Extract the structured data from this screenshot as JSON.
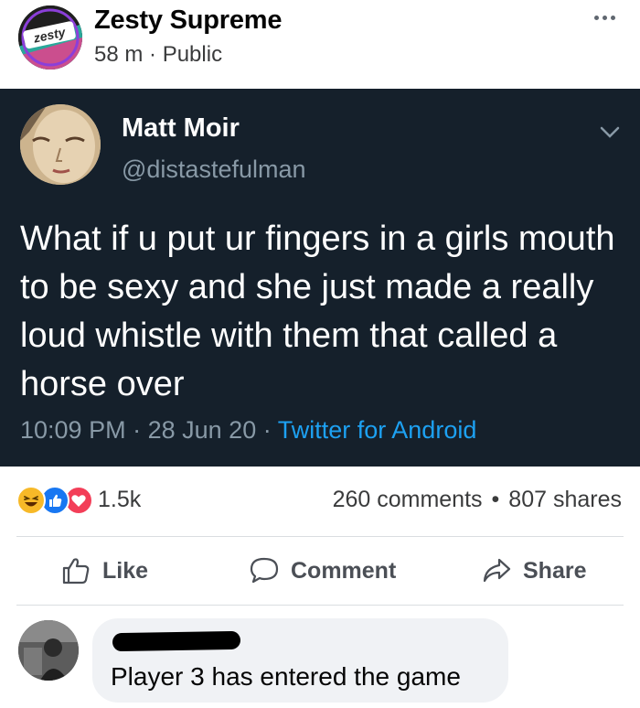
{
  "post": {
    "page_name": "Zesty Supreme",
    "avatar_text": "zesty",
    "time": "58 m",
    "separator": "·",
    "visibility": "Public"
  },
  "tweet": {
    "display_name": "Matt Moir",
    "handle": "@distastefulman",
    "text": "What if u put ur fingers in a girls mouth to be sexy and she just made a really loud whistle with them that called a horse over",
    "time": "10:09 PM",
    "date": "28 Jun 20",
    "separator": "·",
    "source": "Twitter for Android"
  },
  "reactions": {
    "icons": [
      "haha-icon",
      "like-icon",
      "love-icon"
    ],
    "count": "1.5k",
    "comments": "260 comments",
    "separator": "•",
    "shares": "807 shares"
  },
  "actions": {
    "like": "Like",
    "comment": "Comment",
    "share": "Share"
  },
  "comment": {
    "text": "Player 3 has entered the game"
  },
  "colors": {
    "tweet_bg": "#15202b",
    "tweet_secondary": "#8899a6",
    "twitter_blue": "#1da1f2",
    "fb_like_blue": "#1877f2",
    "love_red": "#f33e58",
    "haha_yellow": "#f7b928"
  }
}
